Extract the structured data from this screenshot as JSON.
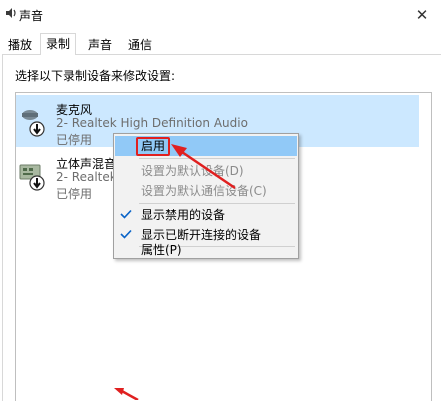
{
  "window": {
    "title": "声音",
    "close_glyph": "✕"
  },
  "tabs": [
    "播放",
    "录制",
    "声音",
    "通信"
  ],
  "active_tab": 1,
  "instruction": "选择以下录制设备来修改设置:",
  "devices": [
    {
      "name": "麦克风",
      "sub": "2- Realtek High Definition Audio",
      "status": "已停用",
      "selected": true,
      "icon": "microphone-icon"
    },
    {
      "name": "立体声混音",
      "sub": "2- Realtek",
      "status": "已停用",
      "selected": false,
      "icon": "stereo-mix-icon"
    }
  ],
  "context_menu": {
    "items": [
      {
        "label": "启用",
        "highlighted": true,
        "disabled": false,
        "checked": false
      },
      {
        "label": "设置为默认设备(D)",
        "highlighted": false,
        "disabled": true,
        "checked": false
      },
      {
        "label": "设置为默认通信设备(C)",
        "highlighted": false,
        "disabled": true,
        "checked": false
      },
      {
        "label": "显示禁用的设备",
        "highlighted": false,
        "disabled": false,
        "checked": true
      },
      {
        "label": "显示已断开连接的设备",
        "highlighted": false,
        "disabled": false,
        "checked": true
      },
      {
        "label": "属性(P)",
        "highlighted": false,
        "disabled": false,
        "checked": false
      }
    ]
  },
  "colors": {
    "selection": "#cce8ff",
    "highlight": "#91c9f7",
    "annotation": "#e02020",
    "check": "#0a64c8"
  }
}
